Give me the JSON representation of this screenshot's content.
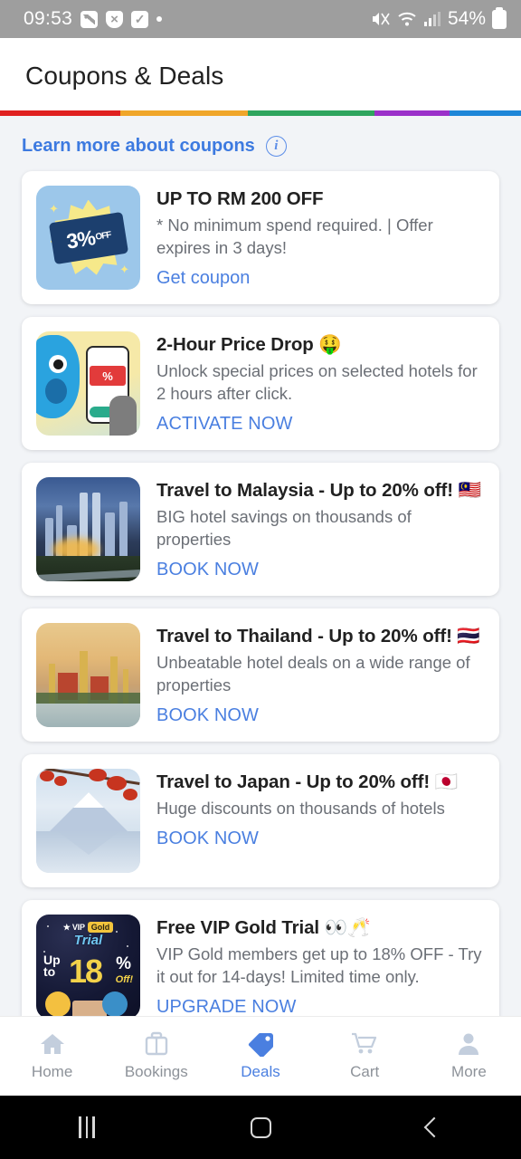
{
  "status_bar": {
    "time": "09:53",
    "battery_percent": "54%",
    "left_icons": [
      "image-icon",
      "shield-x-icon",
      "checkbox-icon",
      "dot-icon"
    ],
    "right_icons": [
      "mute-icon",
      "wifi-icon",
      "signal-icon",
      "battery-icon"
    ]
  },
  "header": {
    "title": "Coupons & Deals",
    "stripe_colors": [
      "#e02020",
      "#f0a62a",
      "#2fa55e",
      "#9b30c9",
      "#1e86d8"
    ]
  },
  "learn_more": {
    "label": "Learn more about coupons",
    "icon": "info-icon",
    "color": "#3d7ae0"
  },
  "theme": {
    "accent": "#4a7fe0",
    "link": "#3d7ae0",
    "page_bg": "#f2f4f7",
    "card_bg": "#ffffff",
    "title_color": "#212121",
    "desc_color": "#6b6f76"
  },
  "deals": [
    {
      "thumb": "coupon-3-percent-off-icon",
      "thumb_text": {
        "percent": "3%",
        "off": "OFF"
      },
      "title": "UP TO RM 200 OFF",
      "description": "* No minimum spend required. | Offer expires in 3 days!",
      "cta": "Get coupon"
    },
    {
      "thumb": "price-drop-phone-icon",
      "thumb_text": {
        "percent": "%"
      },
      "title": "2-Hour Price Drop 🤑",
      "description": "Unlock special prices on selected hotels for 2 hours after click.",
      "cta": "ACTIVATE NOW"
    },
    {
      "thumb": "kuala-lumpur-skyline-photo",
      "title": "Travel to Malaysia - Up to 20% off! 🇲🇾",
      "description": "BIG hotel savings on thousands of properties",
      "cta": "BOOK NOW"
    },
    {
      "thumb": "thailand-temple-photo",
      "title": "Travel to Thailand - Up to 20% off! 🇹🇭",
      "description": "Unbeatable hotel deals on a wide range of properties",
      "cta": "BOOK NOW"
    },
    {
      "thumb": "mount-fuji-photo",
      "title": "Travel to Japan - Up to 20% off! 🇯🇵",
      "description": "Huge discounts on thousands of hotels",
      "cta": "BOOK NOW"
    },
    {
      "thumb": "vip-gold-trial-icon",
      "thumb_text": {
        "vip": "★ VIP",
        "gold": "Gold",
        "trial": "Trial",
        "up": "Up",
        "to": "to",
        "number": "18",
        "percent": "%",
        "off": "Off!"
      },
      "title": "Free VIP Gold Trial 👀🥂",
      "description": "VIP Gold members get up to 18% OFF - Try it out for 14-days! Limited time only.",
      "cta": "UPGRADE NOW"
    }
  ],
  "bottom_nav": {
    "active": "Deals",
    "items": [
      {
        "label": "Home",
        "icon": "home-icon"
      },
      {
        "label": "Bookings",
        "icon": "suitcase-icon"
      },
      {
        "label": "Deals",
        "icon": "tag-icon"
      },
      {
        "label": "Cart",
        "icon": "cart-icon"
      },
      {
        "label": "More",
        "icon": "person-icon"
      }
    ]
  },
  "system_nav": {
    "items": [
      "recents-button",
      "home-button",
      "back-button"
    ]
  }
}
